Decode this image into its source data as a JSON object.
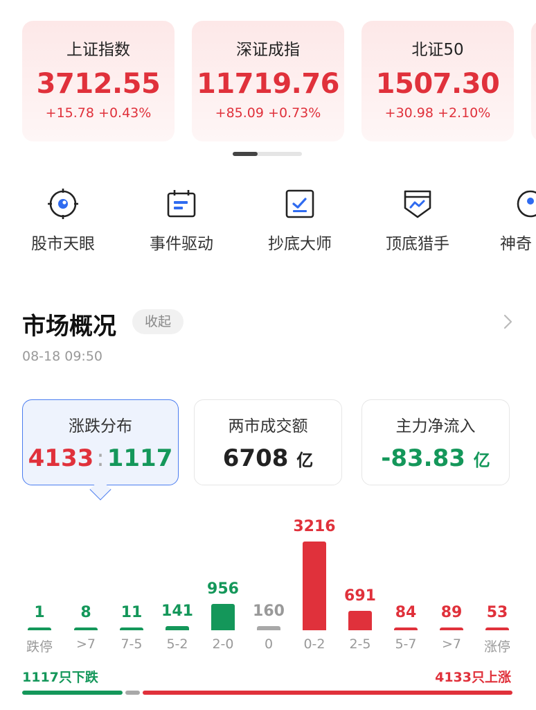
{
  "indices": [
    {
      "name": "上证指数",
      "value": "3712.55",
      "change": "+15.78 +0.43%"
    },
    {
      "name": "深证成指",
      "value": "11719.76",
      "change": "+85.09 +0.73%"
    },
    {
      "name": "北证50",
      "value": "1507.30",
      "change": "+30.98 +2.10%"
    }
  ],
  "tools": [
    {
      "label": "股市天眼",
      "icon": "eye-target-icon"
    },
    {
      "label": "事件驱动",
      "icon": "calendar-icon"
    },
    {
      "label": "抄底大师",
      "icon": "checkbox-icon"
    },
    {
      "label": "顶底猎手",
      "icon": "shield-chart-icon"
    },
    {
      "label": "神奇",
      "icon": "magic-icon"
    }
  ],
  "market": {
    "title": "市场概况",
    "collapse_label": "收起",
    "time": "08-18 09:50"
  },
  "stats": {
    "updown": {
      "label": "涨跌分布",
      "up": "4133",
      "sep": ":",
      "down": "1117"
    },
    "turnover": {
      "label": "两市成交额",
      "value": "6708",
      "unit": "亿"
    },
    "mainflow": {
      "label": "主力净流入",
      "value": "-83.83",
      "unit": "亿"
    }
  },
  "chart_data": {
    "type": "bar",
    "categories": [
      "跌停",
      ">7",
      "7-5",
      "5-2",
      "2-0",
      "0",
      "0-2",
      "2-5",
      "5-7",
      ">7",
      "涨停"
    ],
    "values": [
      1,
      8,
      11,
      141,
      956,
      160,
      3216,
      691,
      84,
      89,
      53
    ],
    "value_labels": [
      "1",
      "8",
      "11",
      "141",
      "956",
      "160",
      "3216",
      "691",
      "84",
      "89",
      "53"
    ],
    "colors": [
      "#14975a",
      "#14975a",
      "#14975a",
      "#14975a",
      "#14975a",
      "#a8a8a8",
      "#e0313b",
      "#e0313b",
      "#e0313b",
      "#e0313b",
      "#e0313b"
    ]
  },
  "summary": {
    "down_text": "1117只下跌",
    "up_text": "4133只上涨",
    "down_count": 1117,
    "flat_count": 160,
    "up_count": 4133
  },
  "colors": {
    "up": "#e0313b",
    "down": "#14975a",
    "flat": "#a8a8a8",
    "accent": "#4a7cf0"
  }
}
